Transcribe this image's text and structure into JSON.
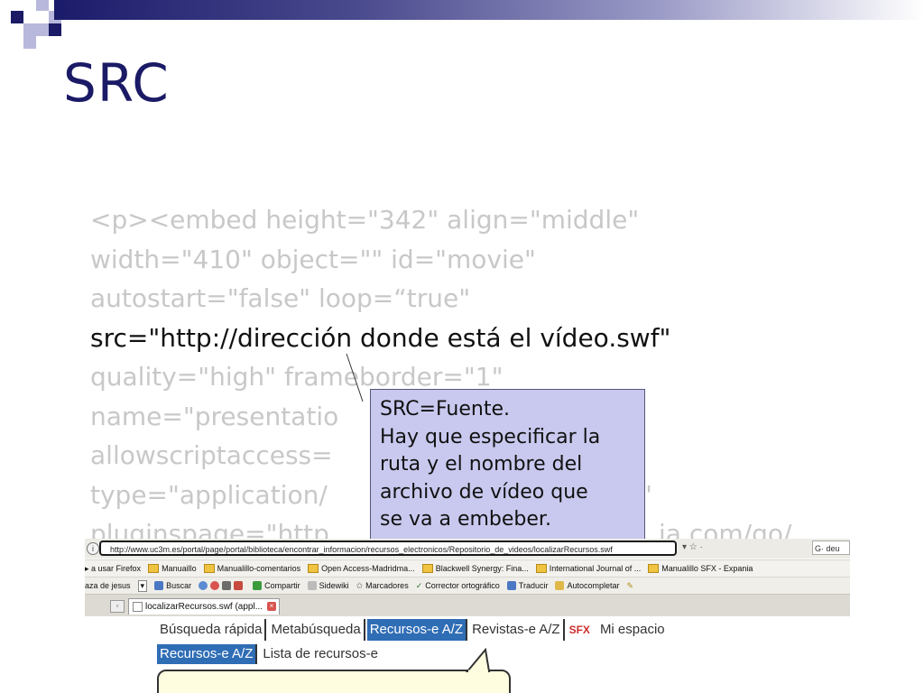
{
  "slide": {
    "title": "SRC",
    "code_lines": [
      "<p><embed height=\"342\" align=\"middle\"",
      "width=\"410\" object=\"\" id=\"movie\"",
      "autostart=\"false\" loop=“true\"",
      "src=\"http://dirección donde está el vídeo.swf\"",
      "quality=\"high\" frameborder=\"1\"",
      "name=\"presentatio",
      "allowscriptaccess=",
      "type=\"application/",
      "pluginspage=\"http"
    ],
    "code_line_tails": {
      "line_8": "\"",
      "line_9": "ia.com/go/"
    },
    "callout": {
      "lines": [
        "SRC=Fuente.",
        "Hay que especificar la",
        "ruta y el nombre del",
        "archivo de vídeo que",
        "se va a embeber."
      ]
    }
  },
  "browser": {
    "url": "http://www.uc3m.es/portal/page/portal/biblioteca/encontrar_informacion/recursos_electronicos/Repositorio_de_videos/localizarRecursos.swf",
    "addr_tail": "▾ ☆ ·",
    "google_text": "G· deu",
    "bookmarks": [
      "a usar Firefox",
      "Manuaillo",
      "Manualillo-comentarios",
      "Open Access-Madridma...",
      "Blackwell Synergy: Fina...",
      "International Journal of ...",
      "Manualillo SFX - Expania"
    ],
    "toolbar": {
      "search_prefix": "aza de jesus",
      "items": [
        "Buscar",
        "Compartir",
        "Sidewiki",
        "Marcadores",
        "Corrector ortográfico",
        "Traducir",
        "Autocompletar"
      ]
    },
    "tab_title": "localizarRecursos.swf (appl...",
    "nav_menu": [
      "Búsqueda rápida",
      "Metabúsqueda",
      "Recursos-e A/Z",
      "Revistas-e A/Z",
      "SFX",
      "Mi espacio"
    ],
    "sub_menu": [
      "Recursos-e A/Z",
      "Lista de recursos-e"
    ]
  },
  "colors": {
    "title": "#1a1a66",
    "callout_bg": "#c9c9ef",
    "code_dim": "#c8c8c8",
    "nav_active": "#2f6db5",
    "sfx": "#cc2e2e"
  }
}
